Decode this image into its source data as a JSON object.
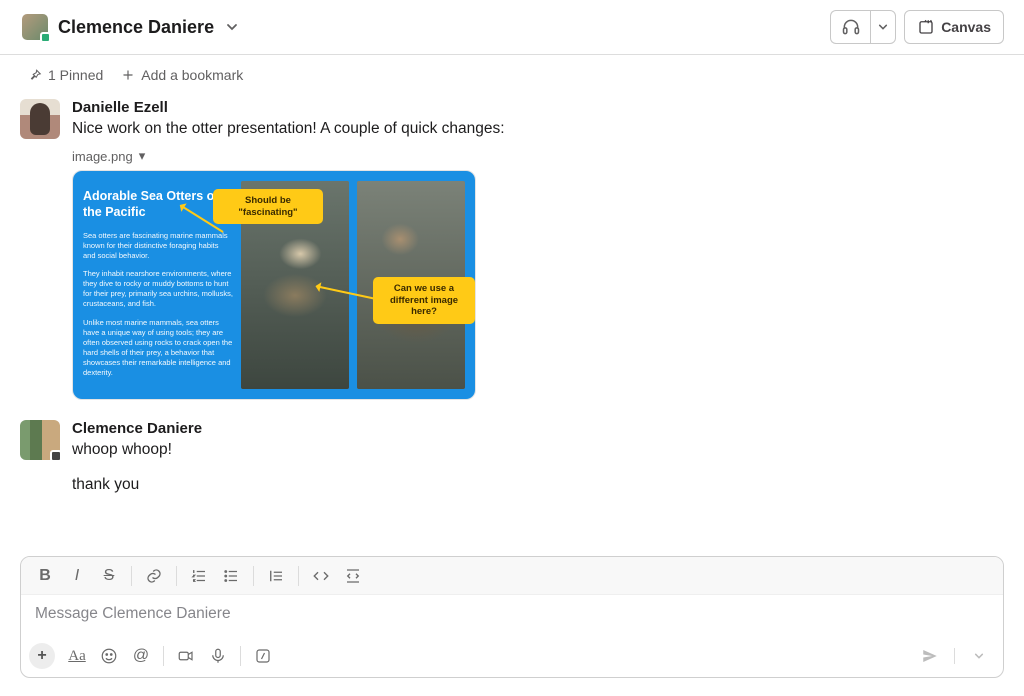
{
  "header": {
    "channel_name": "Clemence Daniere",
    "canvas_label": "Canvas"
  },
  "bookmarks": {
    "pinned_label": "1 Pinned",
    "add_bookmark_label": "Add a bookmark"
  },
  "messages": [
    {
      "author": "Danielle Ezell",
      "text": "Nice work on the otter presentation! A couple of quick changes:",
      "attachment_name": "image.png",
      "slide": {
        "title": "Adorable Sea Otters of the Pacific",
        "para1": "Sea otters are fascinating marine mammals known for their distinctive foraging habits and social behavior.",
        "para2": "They inhabit nearshore environments, where they dive to rocky or muddy bottoms to hunt for their prey, primarily sea urchins, mollusks, crustaceans, and fish.",
        "para3": "Unlike most marine mammals, sea otters have a unique way of using tools; they are often observed using rocks to crack open the hard shells of their prey, a behavior that showcases their remarkable intelligence and dexterity.",
        "annotation1": "Should be \"fascinating\"",
        "annotation2": "Can we use a different image here?"
      }
    },
    {
      "author": "Clemence Daniere",
      "text": "whoop whoop!",
      "followup": "thank you"
    }
  ],
  "composer": {
    "placeholder": "Message Clemence Daniere"
  }
}
